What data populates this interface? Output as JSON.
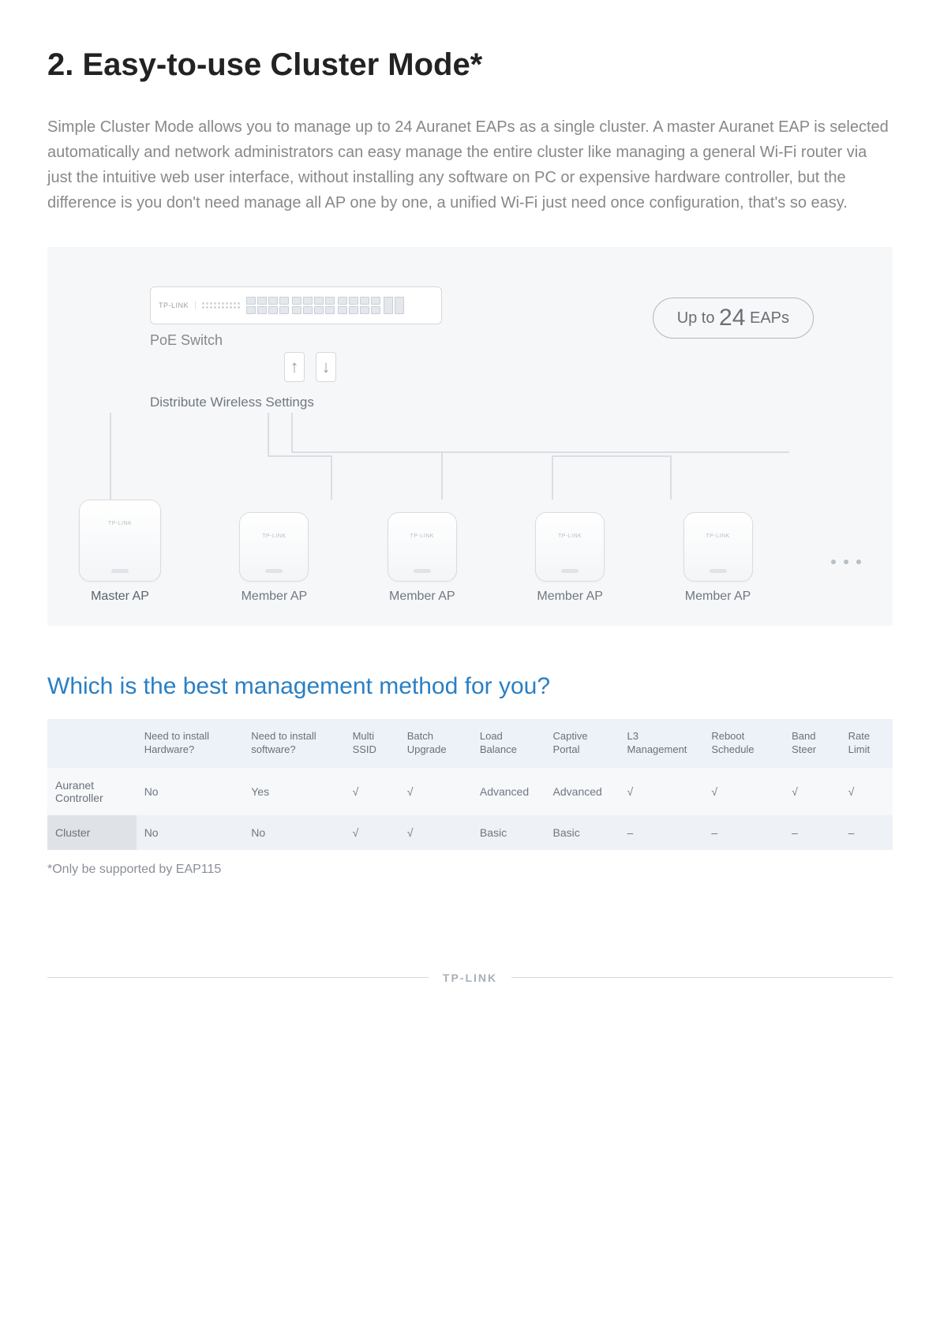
{
  "title": "2. Easy-to-use Cluster Mode*",
  "intro": "Simple Cluster Mode allows you to manage up to 24 Auranet EAPs as a single cluster. A master Auranet EAP is selected automatically and network administrators can easy manage the entire cluster like managing a general Wi-Fi router via just the intuitive web user interface, without installing any software on PC or expensive hardware controller, but the difference is you don't need manage all AP one by one, a unified Wi-Fi just need once configuration, that's so easy.",
  "diagram": {
    "switch_brand": "TP-LINK",
    "switch_label": "PoE Switch",
    "badge_prefix": "Up to ",
    "badge_number": "24",
    "badge_suffix": " EAPs",
    "distribute_label": "Distribute Wireless Settings",
    "ap_brand": "TP-LINK",
    "aps": [
      {
        "label": "Master AP",
        "class": "master"
      },
      {
        "label": "Member AP",
        "class": ""
      },
      {
        "label": "Member AP",
        "class": ""
      },
      {
        "label": "Member AP",
        "class": ""
      },
      {
        "label": "Member AP",
        "class": ""
      }
    ]
  },
  "subheading": "Which is the best management method for you?",
  "table": {
    "headers": [
      "",
      "Need to install Hardware?",
      "Need to install software?",
      "Multi SSID",
      "Batch Upgrade",
      "Load Balance",
      "Captive Portal",
      "L3 Management",
      "Reboot Schedule",
      "Band Steer",
      "Rate Limit"
    ],
    "rows": [
      {
        "label": "Auranet Controller",
        "cells": [
          "No",
          "Yes",
          "√",
          "√",
          "Advanced",
          "Advanced",
          "√",
          "√",
          "√",
          "√"
        ]
      },
      {
        "label": "Cluster",
        "cells": [
          "No",
          "No",
          "√",
          "√",
          "Basic",
          "Basic",
          "–",
          "–",
          "–",
          "–"
        ]
      }
    ]
  },
  "footnote": "*Only be supported by EAP115",
  "footer_brand": "TP-LINK"
}
